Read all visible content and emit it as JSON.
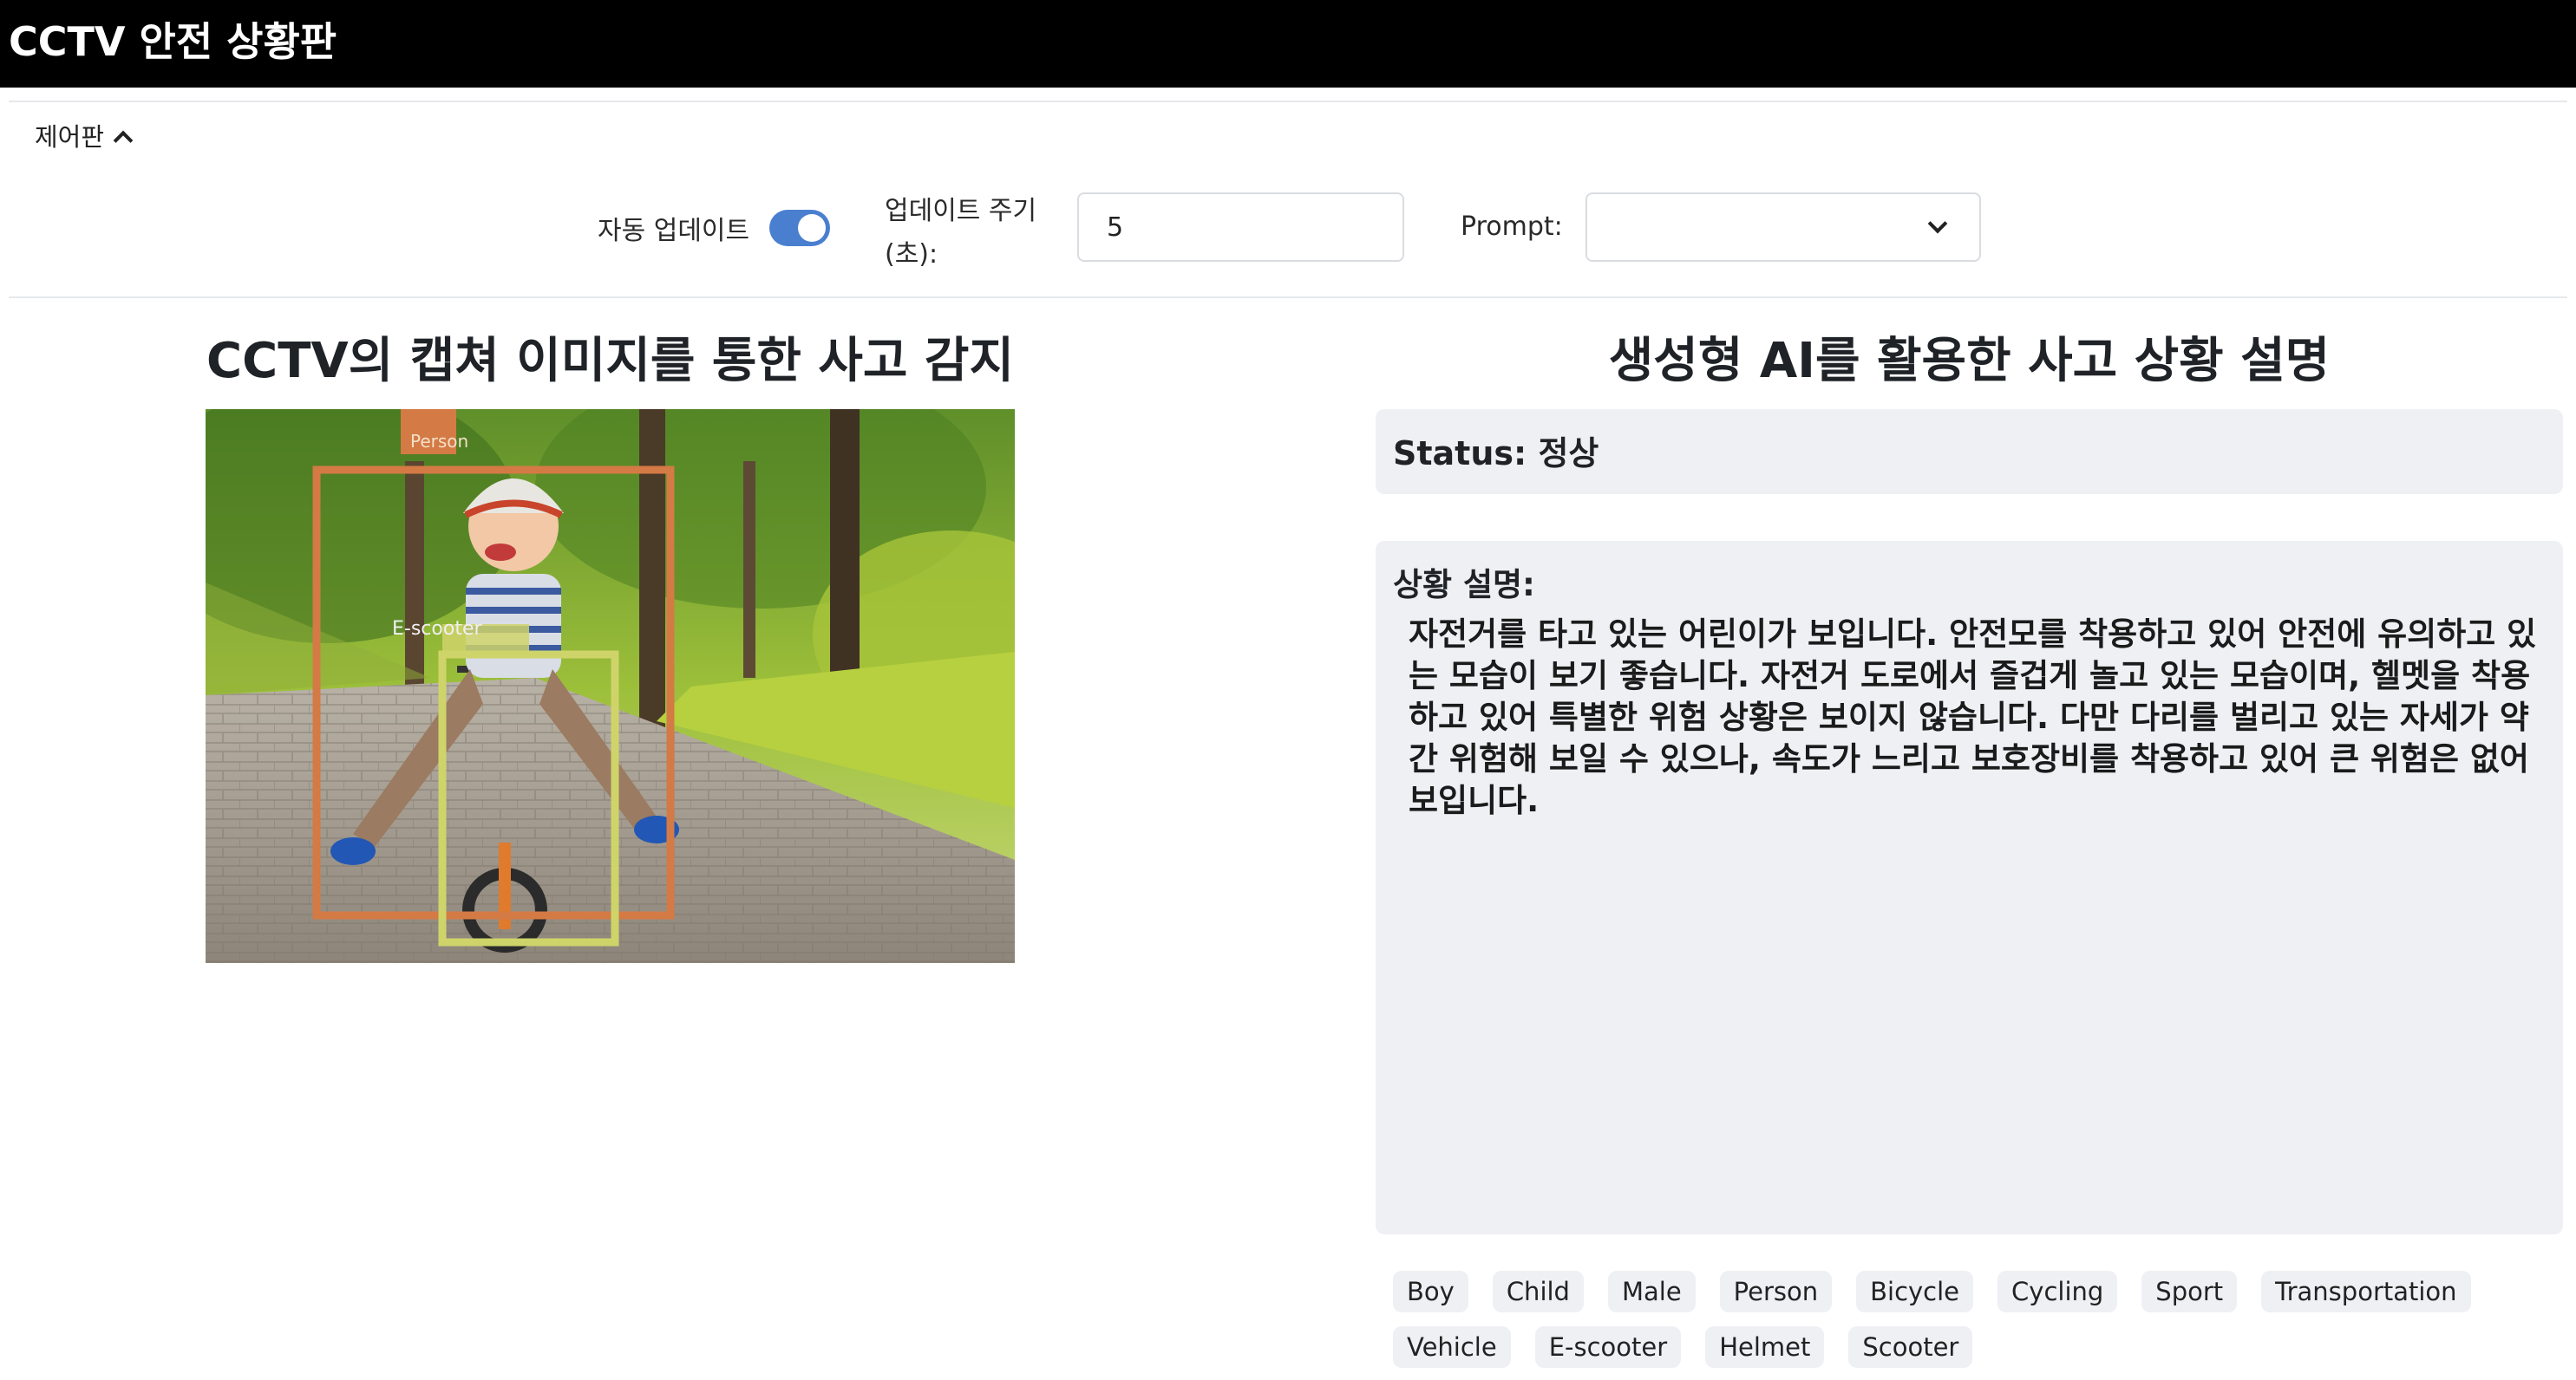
{
  "header": {
    "title": "CCTV 안전 상황판"
  },
  "control_panel": {
    "toggle_label": "제어판",
    "auto_update_label": "자동 업데이트",
    "auto_update_on": true,
    "interval_label_line1": "업데이트 주기",
    "interval_label_line2": "(초):",
    "interval_value": "5",
    "prompt_label": "Prompt:",
    "prompt_value": ""
  },
  "detection": {
    "title": "CCTV의 캡쳐 이미지를 통한 사고 감지",
    "boxes": [
      {
        "label": "Person",
        "color": "#d47a45"
      },
      {
        "label": "E-scooter",
        "color": "#cfd46a"
      }
    ]
  },
  "explanation": {
    "title": "생성형 AI를 활용한 사고 상황 설명",
    "status": "Status: 정상",
    "description_title": "상황 설명:",
    "description": "자전거를 타고 있는 어린이가 보입니다. 안전모를 착용하고 있어 안전에 유의하고 있는 모습이 보기 좋습니다. 자전거 도로에서 즐겁게 놀고 있는 모습이며, 헬멧을 착용하고 있어 특별한 위험 상황은 보이지 않습니다. 다만 다리를 벌리고 있는 자세가 약간 위험해 보일 수 있으나, 속도가 느리고 보호장비를 착용하고 있어 큰 위험은 없어 보입니다."
  },
  "tags": [
    "Boy",
    "Child",
    "Male",
    "Person",
    "Bicycle",
    "Cycling",
    "Sport",
    "Transportation",
    "Vehicle",
    "E-scooter",
    "Helmet",
    "Scooter"
  ],
  "colors": {
    "header_bg": "#000000",
    "accent": "#4a7fd0",
    "card_bg": "#eef0f4"
  }
}
